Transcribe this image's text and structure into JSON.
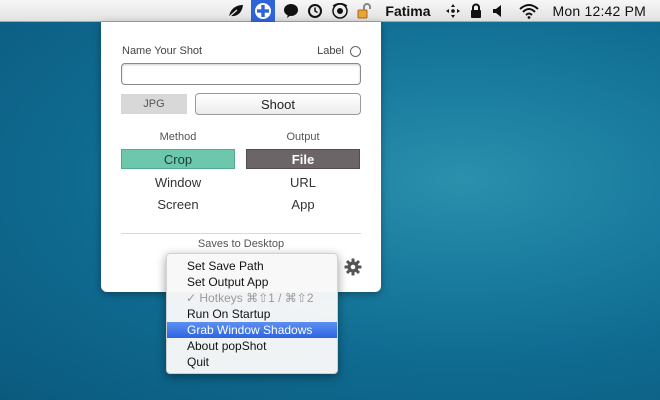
{
  "menubar": {
    "user": "Fatima",
    "clock": "Mon 12:42 PM",
    "icons": [
      "leaf-icon",
      "popshot-icon",
      "speech-bubble-icon",
      "time-machine-icon",
      "eye-icon",
      "unlock-icon",
      "move-arrows-icon",
      "lock-icon",
      "volume-icon",
      "wifi-icon"
    ]
  },
  "panel": {
    "name_label": "Name Your Shot",
    "label_toggle": "Label",
    "name_value": "",
    "format": "JPG",
    "shoot": "Shoot",
    "method_header": "Method",
    "output_header": "Output",
    "methods": [
      "Crop",
      "Window",
      "Screen"
    ],
    "outputs": [
      "File",
      "URL",
      "App"
    ],
    "selected_method": "Crop",
    "selected_output": "File",
    "saves_to": "Saves to Desktop",
    "colors": {
      "method_selected": "#6dc7ac",
      "output_selected": "#6b6567"
    }
  },
  "menu": {
    "items": [
      {
        "label": "Set Save Path",
        "state": "normal"
      },
      {
        "label": "Set Output App",
        "state": "normal"
      },
      {
        "label": "✓ Hotkeys ⌘⇧1 / ⌘⇧2",
        "state": "disabled"
      },
      {
        "label": "Run On Startup",
        "state": "normal"
      },
      {
        "label": "Grab Window Shadows",
        "state": "highlighted"
      },
      {
        "label": "About popShot",
        "state": "normal"
      },
      {
        "label": "Quit",
        "state": "normal"
      }
    ],
    "highlight_color": "#2d65e2"
  }
}
